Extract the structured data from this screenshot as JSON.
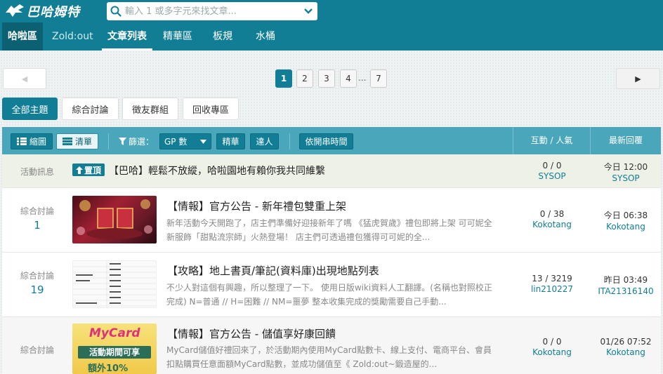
{
  "brand": {
    "logo_text": "巴哈姆特"
  },
  "search": {
    "placeholder": "輸入 1 或多字元來找文章..."
  },
  "nav": {
    "items": [
      "哈啦區",
      "Zold:out",
      "文章列表",
      "精華區",
      "板規",
      "水桶"
    ],
    "active": "文章列表"
  },
  "pagination": {
    "prev": "◀",
    "next": "▶",
    "pages": [
      "1",
      "2",
      "3",
      "4",
      "7"
    ],
    "current": "1",
    "ellipsis": "..."
  },
  "filter_tabs": [
    "全部主題",
    "綜合討論",
    "徵友群組",
    "回收專區"
  ],
  "toolbar": {
    "view_thumb": "縮圖",
    "view_list": "清單",
    "filter_label": "篩選：",
    "sort_select": "GP 數",
    "essence": "精華",
    "expert": "達人",
    "by_time": "依開串時間",
    "col_interact": "互動 / 人氣",
    "col_latest": "最新回覆"
  },
  "rows": [
    {
      "type": "sticky",
      "category": "活動訊息",
      "pin": "置頂",
      "title": "【巴哈】輕鬆不放縱，哈啦園地有賴你我共同維繫",
      "stat": "0 / 0",
      "stat_user": "SYSOP",
      "last_time": "今日 12:00",
      "last_user": "SYSOP"
    },
    {
      "category": "綜合討論",
      "count": "1",
      "title": "【情報】官方公告 - 新年禮包雙重上架",
      "desc": "新年活動今天開跑了，店主們準備好迎接新年了嗎 《猛虎賀歲》禮包即將上架 可可妮全新服飾「甜點流宗師」火熱登場！ 店主們可透過禮包獲得可可妮的全...",
      "stat": "0 / 38",
      "stat_user": "Kokotang",
      "last_time": "今日 06:38",
      "last_user": "Kokotang"
    },
    {
      "category": "綜合討論",
      "count": "19",
      "title": "【攻略】地上書頁/筆記(資料庫)出現地點列表",
      "desc": "不少人對這個有興趣，所以整理了一下。 使用日版wiki資料人工翻譯。(名稱也對照校正完成) N=普通 // H=困難 // NM=噩夢 整本收集完成的獎勵需要自己手動...",
      "stat": "13 / 3219",
      "stat_user": "lin210227",
      "last_time": "昨日 03:49",
      "last_user": "ITA21316140"
    },
    {
      "category": "綜合討論",
      "count": "",
      "title": "【情報】官方公告 - 儲值享好康回饋",
      "desc": "MyCard儲值好禮回來了，於活動期內使用MyCard點數卡、線上支付、電商平台、會員扣點購買任意面額MyCard點數，並成功儲值至《 Zold:out~鍛造屋的...",
      "stat": "0 / 0",
      "stat_user": "Kokotang",
      "last_time": "01/26 07:52",
      "last_user": "Kokotang",
      "thumb_text": [
        "MyCard",
        "活動期間可享",
        "額外10%"
      ]
    }
  ],
  "colors": {
    "primary": "#117e96",
    "header_bar": "#4aa6ba",
    "sticky_bg": "#eef1e6"
  }
}
